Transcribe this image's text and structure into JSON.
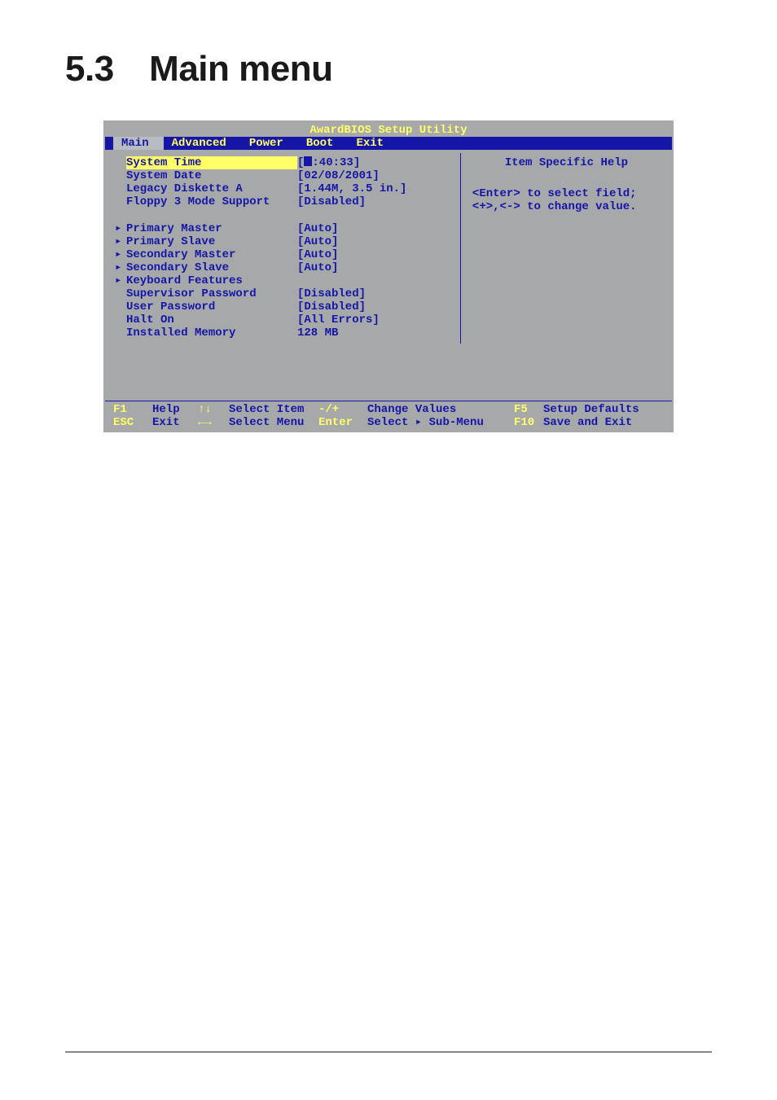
{
  "heading": {
    "label": "5.3 Main menu"
  },
  "bios": {
    "title": "AwardBIOS Setup Utility",
    "menu": {
      "main": "Main",
      "advanced": "Advanced",
      "power": "Power",
      "boot": "Boot",
      "exit": "Exit"
    },
    "items": [
      {
        "label": "System Time",
        "value": "[  :40:33]",
        "highlight": true
      },
      {
        "label": "System Date",
        "value": "[02/08/2001]"
      },
      {
        "label": "Legacy Diskette A",
        "value": "[1.44M, 3.5 in.]"
      },
      {
        "label": "Floppy 3 Mode Support",
        "value": "[Disabled]"
      },
      {
        "label": "",
        "value": ""
      },
      {
        "arrow": true,
        "label": "Primary Master",
        "value": "[Auto]"
      },
      {
        "arrow": true,
        "label": "Primary Slave",
        "value": "[Auto]"
      },
      {
        "arrow": true,
        "label": "Secondary Master",
        "value": "[Auto]"
      },
      {
        "arrow": true,
        "label": "Secondary Slave",
        "value": "[Auto]"
      },
      {
        "arrow": true,
        "label": "Keyboard Features",
        "value": ""
      },
      {
        "label": "Supervisor Password",
        "value": "[Disabled]"
      },
      {
        "label": "User Password",
        "value": "[Disabled]"
      },
      {
        "label": "Halt On",
        "value": "[All Errors]"
      },
      {
        "label": "Installed Memory",
        "value": "128 MB"
      }
    ],
    "help": {
      "title": "Item Specific Help",
      "body": "<Enter> to select field;\n<+>,<-> to change value."
    },
    "footer": {
      "r1c1": "F1",
      "r1c2": "Help",
      "r1c3": "↑↓",
      "r1c4": "Select Item",
      "r1c5": "-/+",
      "r1c6": "Change Values",
      "r1c7": "F5",
      "r1c8": "Setup Defaults",
      "r2c1": "ESC",
      "r2c2": "Exit",
      "r2c3": "←→",
      "r2c4": "Select Menu",
      "r2c5": "Enter",
      "r2c6": "Select ▸ Sub-Menu",
      "r2c7": "F10",
      "r2c8": "Save and Exit"
    }
  }
}
